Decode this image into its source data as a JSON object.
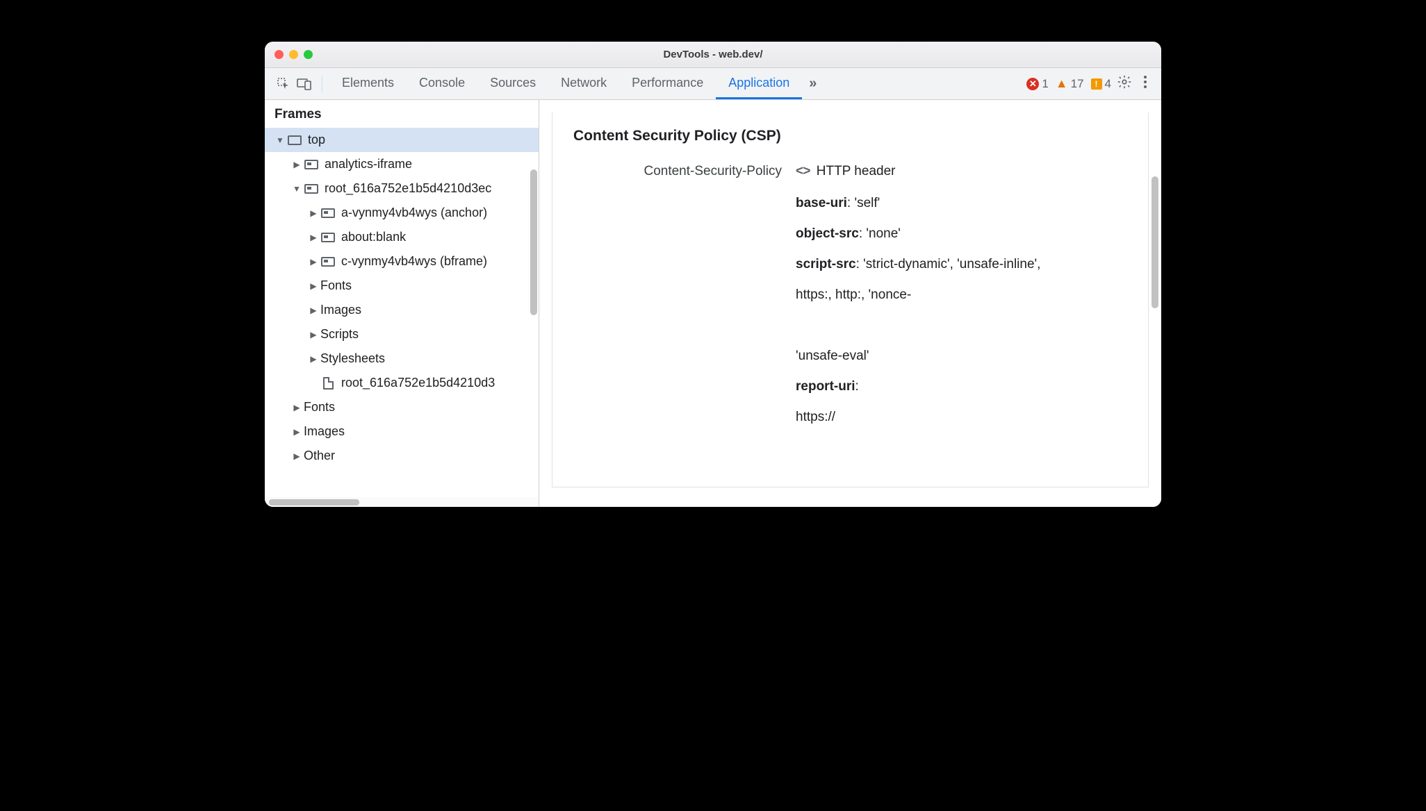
{
  "window": {
    "title": "DevTools - web.dev/"
  },
  "toolbar": {
    "tabs": [
      "Elements",
      "Console",
      "Sources",
      "Network",
      "Performance",
      "Application"
    ],
    "active_tab": "Application",
    "errors": "1",
    "warnings": "17",
    "issues": "4"
  },
  "sidebar": {
    "header": "Frames",
    "tree": [
      {
        "depth": 0,
        "arrow": "down",
        "icon": "frame",
        "label": "top",
        "selected": true
      },
      {
        "depth": 1,
        "arrow": "right",
        "icon": "iframe",
        "label": "analytics-iframe"
      },
      {
        "depth": 1,
        "arrow": "down",
        "icon": "iframe",
        "label": "root_616a752e1b5d4210d3ec"
      },
      {
        "depth": 2,
        "arrow": "right",
        "icon": "iframe",
        "label": "a-vynmy4vb4wys (anchor)"
      },
      {
        "depth": 2,
        "arrow": "right",
        "icon": "iframe",
        "label": "about:blank"
      },
      {
        "depth": 2,
        "arrow": "right",
        "icon": "iframe",
        "label": "c-vynmy4vb4wys (bframe)"
      },
      {
        "depth": 2,
        "arrow": "right",
        "icon": "none",
        "label": "Fonts"
      },
      {
        "depth": 2,
        "arrow": "right",
        "icon": "none",
        "label": "Images"
      },
      {
        "depth": 2,
        "arrow": "right",
        "icon": "none",
        "label": "Scripts"
      },
      {
        "depth": 2,
        "arrow": "right",
        "icon": "none",
        "label": "Stylesheets"
      },
      {
        "depth": 2,
        "arrow": "none",
        "icon": "doc",
        "label": "root_616a752e1b5d4210d3"
      },
      {
        "depth": 1,
        "arrow": "right",
        "icon": "none",
        "label": "Fonts"
      },
      {
        "depth": 1,
        "arrow": "right",
        "icon": "none",
        "label": "Images"
      },
      {
        "depth": 1,
        "arrow": "right",
        "icon": "none",
        "label": "Other"
      }
    ]
  },
  "main": {
    "section_title": "Content Security Policy (CSP)",
    "header_key": "Content-Security-Policy",
    "header_source": "HTTP header",
    "directives": [
      {
        "name": "base-uri",
        "value": ": 'self'"
      },
      {
        "name": "object-src",
        "value": ": 'none'"
      },
      {
        "name": "script-src",
        "value": ": 'strict-dynamic', 'unsafe-inline',"
      },
      {
        "name": "",
        "value": "https:, http:, 'nonce-"
      },
      {
        "name": "",
        "value": ""
      },
      {
        "name": "",
        "value": "'unsafe-eval'"
      },
      {
        "name": "report-uri",
        "value": ":"
      },
      {
        "name": "",
        "value": "https://"
      }
    ]
  }
}
